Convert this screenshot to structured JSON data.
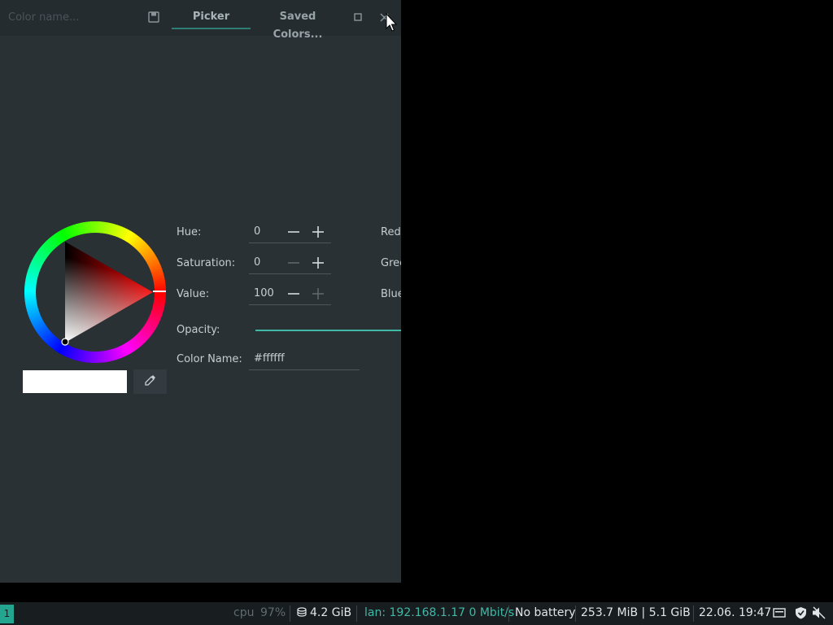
{
  "window": {
    "name_placeholder": "Color name...",
    "tabs": [
      {
        "label": "Picker",
        "active": true
      },
      {
        "label": "Saved Colors...",
        "active": false
      }
    ]
  },
  "picker": {
    "fields": [
      {
        "label": "Hue:",
        "value": "0"
      },
      {
        "label": "Saturation:",
        "value": "0"
      },
      {
        "label": "Value:",
        "value": "100"
      }
    ],
    "rgb_labels": [
      "Red",
      "Green",
      "Blue"
    ],
    "opacity_label": "Opacity:",
    "opacity_fraction": 1.0,
    "color_name_label": "Color Name:",
    "color_name_value": "#ffffff",
    "current_color": "#ffffff"
  },
  "taskbar": {
    "workspace": "1",
    "cpu_label": "cpu",
    "cpu_value": "97%",
    "disk": "4.2 GiB",
    "lan": "lan: 192.168.1.17 0 Mbit/s",
    "battery": "No battery",
    "memory": "253.7 MiB | 5.1 GiB",
    "datetime": "22.06. 19:47"
  },
  "colors": {
    "accent": "#3fb9a6",
    "window_bg": "#2a3135",
    "workspace_bg": "#24a58f"
  }
}
